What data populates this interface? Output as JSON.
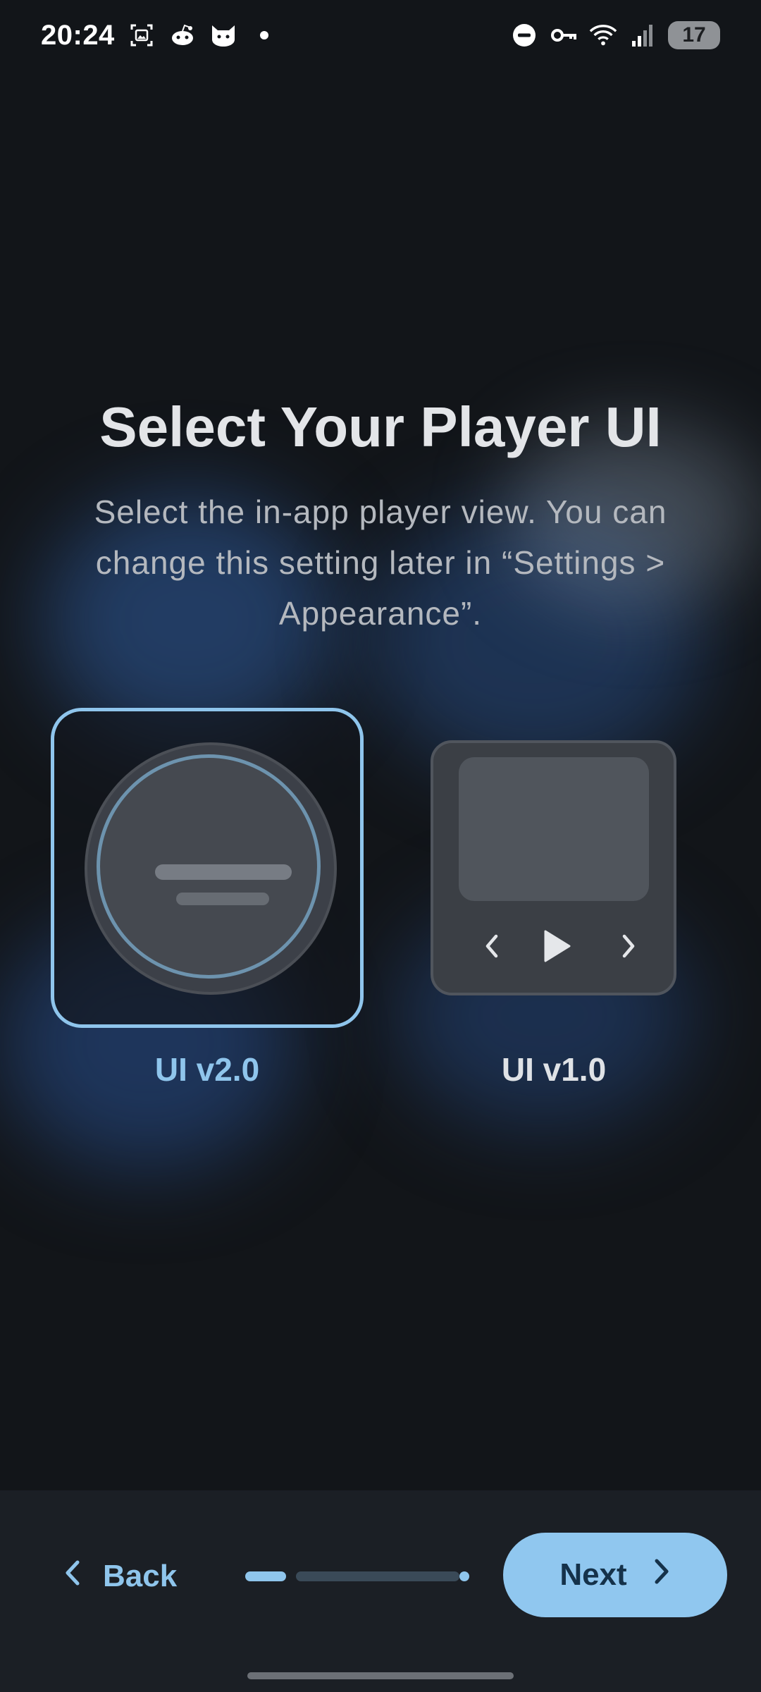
{
  "status_bar": {
    "time": "20:24",
    "battery": "17",
    "left_icons": [
      "screenshot-icon",
      "reddit-icon",
      "cat-app-icon",
      "dot-icon"
    ],
    "right_icons": [
      "do-not-disturb-icon",
      "vpn-key-icon",
      "wifi-icon",
      "cellular-signal-icon",
      "battery-icon"
    ]
  },
  "screen": {
    "title": "Select Your Player UI",
    "description": "Select the in-app player view. You can change this setting later in “Settings > Appearance”."
  },
  "options": [
    {
      "label": "UI v2.0",
      "selected": true
    },
    {
      "label": "UI v1.0",
      "selected": false
    }
  ],
  "navigation": {
    "back_label": "Back",
    "next_label": "Next",
    "progress_step": 1
  },
  "colors": {
    "accent": "#8fc5ec",
    "background": "#121519",
    "bottom_bar": "#1b1f25",
    "next_button": "#90c7ef"
  }
}
